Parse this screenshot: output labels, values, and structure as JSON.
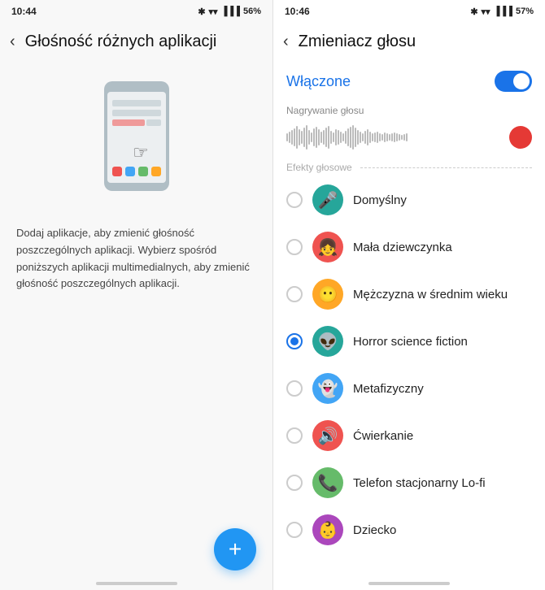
{
  "left": {
    "status_time": "10:44",
    "status_battery": "56%",
    "back_label": "‹",
    "title": "Głośność różnych aplikacji",
    "description": "Dodaj aplikacje, aby zmienić głośność poszczególnych aplikacji. Wybierz spośród poniższych aplikacji multimedialnych, aby zmienić głośność poszczególnych aplikacji.",
    "fab_label": "+",
    "colors": {
      "fab": "#2196F3"
    }
  },
  "right": {
    "status_time": "10:46",
    "status_battery": "57%",
    "back_label": "‹",
    "title": "Zmieniacz głosu",
    "toggle_label": "Włączone",
    "recording_label": "Nagrywanie głosu",
    "effects_label": "Efekty głosowe",
    "voices": [
      {
        "id": "domyslny",
        "name": "Domyślny",
        "color": "#26a69a",
        "icon": "🎤",
        "selected": false
      },
      {
        "id": "mala-dziewczynka",
        "name": "Mała dziewczynka",
        "color": "#ef5350",
        "icon": "👧",
        "selected": false
      },
      {
        "id": "mezczyzna",
        "name": "Mężczyzna w średnim wieku",
        "color": "#FFA726",
        "icon": "😶",
        "selected": false
      },
      {
        "id": "horror",
        "name": "Horror science fiction",
        "color": "#26a69a",
        "icon": "👽",
        "selected": true
      },
      {
        "id": "metafizyczny",
        "name": "Metafizyczny",
        "color": "#42a5f5",
        "icon": "👻",
        "selected": false
      },
      {
        "id": "cwierkanie",
        "name": "Ćwierkanie",
        "color": "#ef5350",
        "icon": "🔊",
        "selected": false
      },
      {
        "id": "telefon",
        "name": "Telefon stacjonarny Lo-fi",
        "color": "#66bb6a",
        "icon": "📞",
        "selected": false
      },
      {
        "id": "dziecko",
        "name": "Dziecko",
        "color": "#ab47bc",
        "icon": "👶",
        "selected": false
      }
    ]
  }
}
